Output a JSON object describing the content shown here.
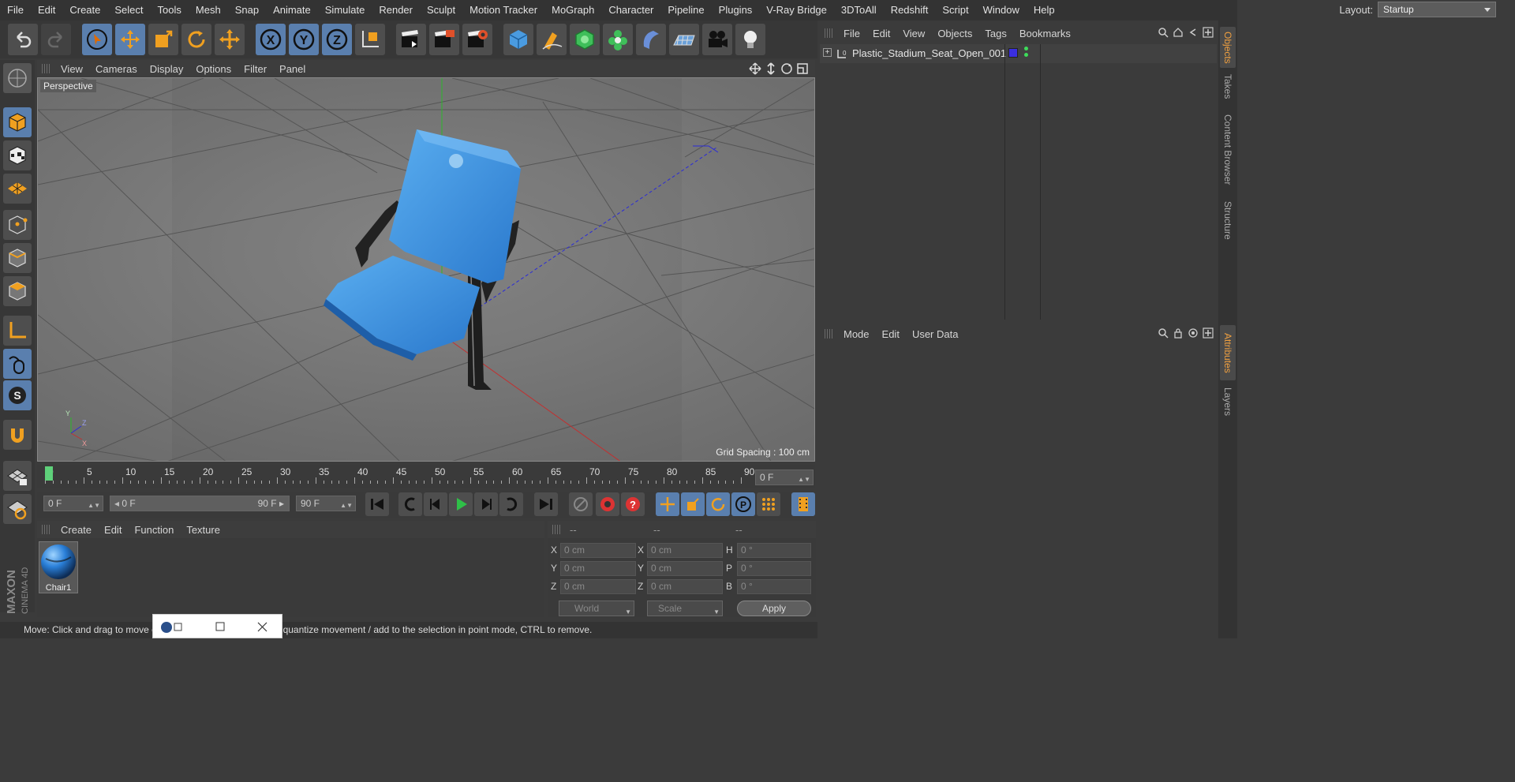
{
  "menu": [
    "File",
    "Edit",
    "Create",
    "Select",
    "Tools",
    "Mesh",
    "Snap",
    "Animate",
    "Simulate",
    "Render",
    "Sculpt",
    "Motion Tracker",
    "MoGraph",
    "Character",
    "Pipeline",
    "Plugins",
    "V-Ray Bridge",
    "3DToAll",
    "Redshift",
    "Script",
    "Window",
    "Help"
  ],
  "layout": {
    "label": "Layout:",
    "value": "Startup"
  },
  "viewport": {
    "menu": [
      "View",
      "Cameras",
      "Display",
      "Options",
      "Filter",
      "Panel"
    ],
    "label": "Perspective",
    "grid_spacing": "Grid Spacing : 100 cm",
    "axis": {
      "y": "Y",
      "z": "Z",
      "x": "X"
    }
  },
  "timeline": {
    "ticks": [
      "0",
      "5",
      "10",
      "15",
      "20",
      "25",
      "30",
      "35",
      "40",
      "45",
      "50",
      "55",
      "60",
      "65",
      "70",
      "75",
      "80",
      "85",
      "90"
    ],
    "current": "0 F"
  },
  "transport": {
    "start": "0 F",
    "range_start": "0 F",
    "range_end": "90 F",
    "end": "90 F"
  },
  "material_manager": {
    "menu": [
      "Create",
      "Edit",
      "Function",
      "Texture"
    ],
    "material": "Chair1"
  },
  "coordinates": {
    "headers": [
      "--",
      "--",
      "--"
    ],
    "rows": [
      {
        "a": "X",
        "av": "0 cm",
        "b": "X",
        "bv": "0 cm",
        "c": "H",
        "cv": "0 °"
      },
      {
        "a": "Y",
        "av": "0 cm",
        "b": "Y",
        "bv": "0 cm",
        "c": "P",
        "cv": "0 °"
      },
      {
        "a": "Z",
        "av": "0 cm",
        "b": "Z",
        "bv": "0 cm",
        "c": "B",
        "cv": "0 °"
      }
    ],
    "mode1": "World",
    "mode2": "Scale",
    "apply": "Apply"
  },
  "object_manager": {
    "menu": [
      "File",
      "Edit",
      "View",
      "Objects",
      "Tags",
      "Bookmarks"
    ],
    "object": "Plastic_Stadium_Seat_Open_001"
  },
  "attributes": {
    "menu": [
      "Mode",
      "Edit",
      "User Data"
    ]
  },
  "right_tabs": [
    "Objects",
    "Takes",
    "Content Browser",
    "Structure",
    "Attributes",
    "Layers"
  ],
  "status": "Move: Click and drag to move elements. Hold down SHIFT to quantize movement / add to the selection in point mode, CTRL to remove.",
  "brand": {
    "line1": "MAXON",
    "line2": "CINEMA 4D"
  },
  "colors": {
    "accent": "#5a7fae",
    "seat": "#3d8fe0",
    "object_color": "#3a2ee0"
  }
}
